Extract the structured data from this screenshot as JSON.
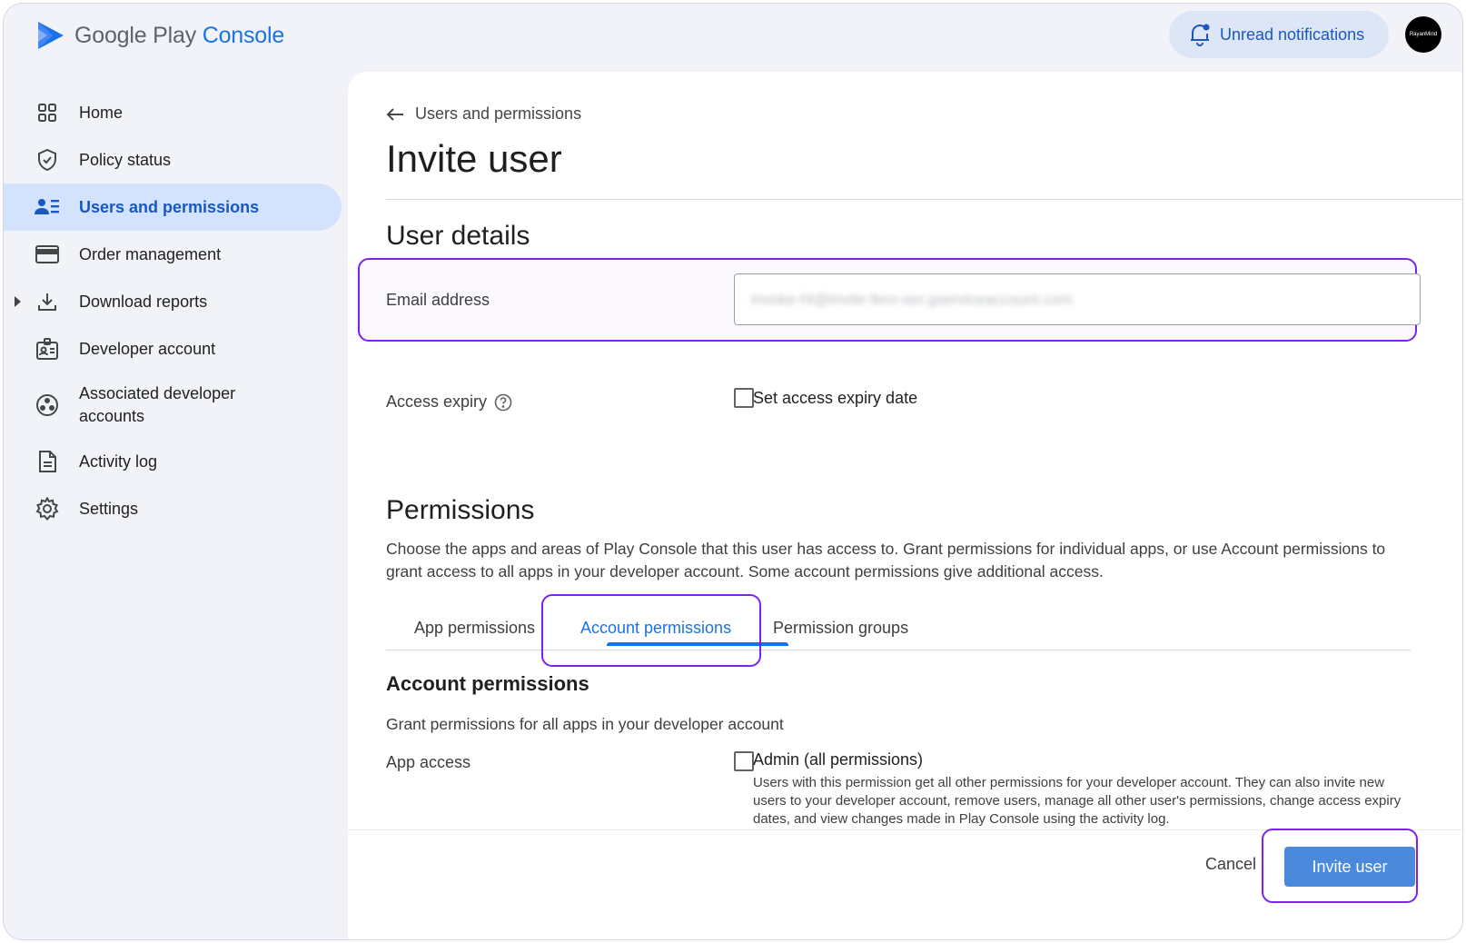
{
  "app": {
    "logo_google": "Google Play",
    "logo_console": "Console"
  },
  "header": {
    "notifications_label": "Unread notifications",
    "avatar_text": "RayanMind"
  },
  "sidebar": {
    "items": [
      {
        "label": "Home",
        "icon": "grid-icon"
      },
      {
        "label": "Policy status",
        "icon": "shield-icon"
      },
      {
        "label": "Users and permissions",
        "icon": "users-list-icon",
        "active": true
      },
      {
        "label": "Order management",
        "icon": "credit-card-icon"
      },
      {
        "label": "Download reports",
        "icon": "download-icon",
        "expandable": true
      },
      {
        "label": "Developer account",
        "icon": "id-badge-icon"
      },
      {
        "label": "Associated developer accounts",
        "icon": "linked-accounts-icon"
      },
      {
        "label": "Activity log",
        "icon": "document-icon"
      },
      {
        "label": "Settings",
        "icon": "gear-icon"
      }
    ]
  },
  "main": {
    "breadcrumb": "Users and permissions",
    "title": "Invite user",
    "user_details": {
      "heading": "User details",
      "email_label": "Email address",
      "email_value": "invoke-f4@invite-fero-ser.gserviceaccount.com",
      "access_expiry_label": "Access expiry",
      "access_expiry_checkbox": "Set access expiry date"
    },
    "permissions": {
      "heading": "Permissions",
      "description": "Choose the apps and areas of Play Console that this user has access to. Grant permissions for individual apps, or use Account permissions to grant access to all apps in your developer account. Some account permissions give additional access.",
      "tabs": [
        {
          "label": "App permissions"
        },
        {
          "label": "Account permissions",
          "active": true
        },
        {
          "label": "Permission groups"
        }
      ],
      "account_heading": "Account permissions",
      "account_desc": "Grant permissions for all apps in your developer account",
      "app_access_label": "App access",
      "admin_label": "Admin (all permissions)",
      "admin_desc": "Users with this permission get all other permissions for your developer account. They can also invite new users to your developer account, remove users, manage all other user's permissions, change access expiry dates, and view changes made in Play Console using the activity log."
    },
    "footer": {
      "cancel": "Cancel",
      "invite": "Invite user"
    }
  },
  "colors": {
    "accent": "#1a73e8",
    "highlight": "#7b22f0",
    "active_nav_bg": "#d3e3fd",
    "primary_button": "#4a89dc"
  }
}
